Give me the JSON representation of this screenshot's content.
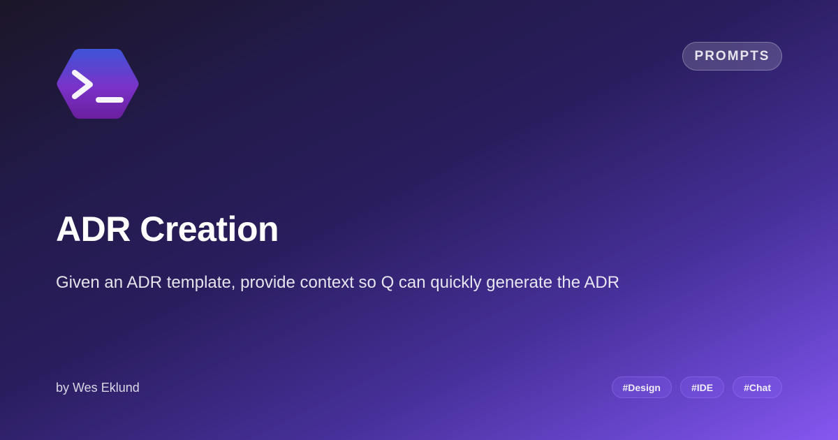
{
  "logo": {
    "icon": "terminal-prompt-icon",
    "shape": "hexagon"
  },
  "category": "PROMPTS",
  "title": "ADR Creation",
  "description": "Given an ADR template, provide context so Q can quickly generate the ADR",
  "author": "by Wes Eklund",
  "tags": [
    "#Design",
    "#IDE",
    "#Chat"
  ],
  "colors": {
    "background_start": "#1c1628",
    "background_end": "#8757f0",
    "logo_top": "#3f54d8",
    "logo_bottom": "#6a1f9e",
    "text": "#ffffff"
  }
}
